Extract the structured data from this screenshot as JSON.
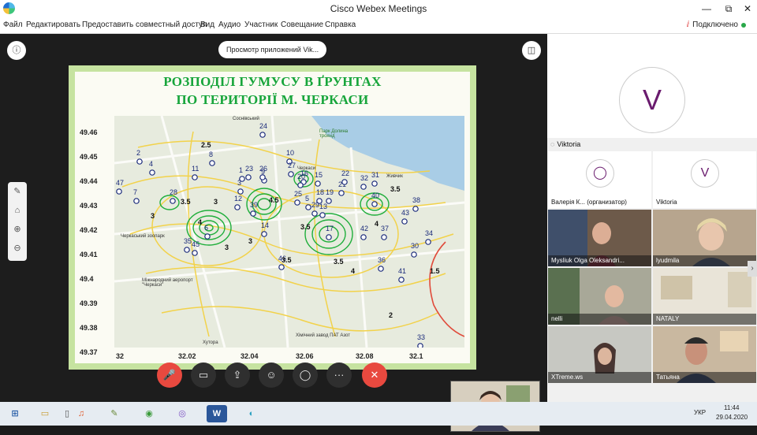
{
  "window": {
    "title": "Cisco Webex Meetings",
    "min": "—",
    "max": "⧉",
    "close": "✕"
  },
  "menu": {
    "items": [
      "Файл",
      "Редактировать",
      "Предоставить совместный доступ",
      "Вид",
      "Аудио",
      "Участник",
      "Совещание",
      "Справка"
    ],
    "status": "Подключено"
  },
  "stage": {
    "view_pill": "Просмотр приложений Vik...",
    "info_icon": "ⓘ",
    "panel_icon": "◫"
  },
  "slide": {
    "title_line1": "РОЗПОДІЛ ГУМУСУ В ҐРУНТАХ",
    "title_line2": "ПО ТЕРИТОРІЇ М. ЧЕРКАСИ",
    "y_ticks": [
      "49.46",
      "49.45",
      "49.44",
      "49.43",
      "49.42",
      "49.41",
      "49.4",
      "49.39",
      "49.38",
      "49.37"
    ],
    "x_ticks": [
      "32",
      "32.02",
      "32.04",
      "32.06",
      "32.08",
      "32.1"
    ],
    "map_labels": {
      "zoo": "Черкаський зоопарк",
      "airport": "Міжнародний аеропорт \"Черкаси\"",
      "plant": "Хімічний завод ПАТ Азот",
      "khutora": "Хутора",
      "park": "Парк Долина троянд",
      "zhyvchyk": "Живчик",
      "sosnivka": "Соснівський",
      "cherkasy": "Черкаси"
    },
    "points": [
      {
        "n": "1"
      },
      {
        "n": "2"
      },
      {
        "n": "3"
      },
      {
        "n": "4"
      },
      {
        "n": "5"
      },
      {
        "n": "6"
      },
      {
        "n": "7"
      },
      {
        "n": "8"
      },
      {
        "n": "9"
      },
      {
        "n": "10"
      },
      {
        "n": "11"
      },
      {
        "n": "12"
      },
      {
        "n": "13"
      },
      {
        "n": "14"
      },
      {
        "n": "15"
      },
      {
        "n": "16"
      },
      {
        "n": "17"
      },
      {
        "n": "18"
      },
      {
        "n": "19"
      },
      {
        "n": "20"
      },
      {
        "n": "21"
      },
      {
        "n": "22"
      },
      {
        "n": "23"
      },
      {
        "n": "24"
      },
      {
        "n": "25"
      },
      {
        "n": "26"
      },
      {
        "n": "27"
      },
      {
        "n": "28"
      },
      {
        "n": "29"
      },
      {
        "n": "30"
      },
      {
        "n": "31"
      },
      {
        "n": "32"
      },
      {
        "n": "33"
      },
      {
        "n": "34"
      },
      {
        "n": "35"
      },
      {
        "n": "36"
      },
      {
        "n": "37"
      },
      {
        "n": "38"
      },
      {
        "n": "39"
      },
      {
        "n": "40"
      },
      {
        "n": "41"
      },
      {
        "n": "42"
      },
      {
        "n": "43"
      },
      {
        "n": "45"
      },
      {
        "n": "46"
      },
      {
        "n": "47"
      }
    ],
    "isoline_values": [
      "2.5",
      "3",
      "3.5",
      "4",
      "4.5",
      "5",
      "1.5",
      "2"
    ]
  },
  "controls": [
    "mute-icon",
    "video-icon",
    "share-icon",
    "participants-icon",
    "chat-icon",
    "more-icon",
    "leave-icon"
  ],
  "control_glyphs": {
    "mute": "🎤",
    "video": "▭",
    "share": "⇪",
    "participants": "☺",
    "chat": "◯",
    "more": "···",
    "leave": "✕"
  },
  "left_tools": [
    "✎",
    "⌂",
    "⊕",
    "⊖"
  ],
  "panel": {
    "active_initial": "V",
    "active_name": "Viktoria",
    "tiles": [
      {
        "name": "Валерія К... (организатор)",
        "kind": "avatar",
        "initial": ""
      },
      {
        "name": "Viktoria",
        "kind": "avatar",
        "initial": "V"
      },
      {
        "name": "Mysliuk Olga Oleksandri...",
        "kind": "video",
        "initial": ""
      },
      {
        "name": "lyudmila",
        "kind": "video",
        "initial": ""
      },
      {
        "name": "nelli",
        "kind": "video",
        "initial": ""
      },
      {
        "name": "NATALY",
        "kind": "video",
        "initial": ""
      },
      {
        "name": "XTreme.ws",
        "kind": "video",
        "initial": ""
      },
      {
        "name": "Татьяна",
        "kind": "video",
        "initial": ""
      }
    ],
    "scroll_arrow": "›"
  },
  "taskbar": {
    "apps": [
      "⊞",
      "▭",
      "▯",
      "♫",
      "✎",
      "◉",
      "◎",
      "W",
      "◐"
    ],
    "tray_lang": "УКР",
    "time": "11:44",
    "date": "29.04.2020"
  },
  "colors": {
    "isoline_green": "#1fae3b",
    "isoline_yellow": "#f2d24a",
    "title_green": "#17a53b",
    "leave_red": "#e8493f",
    "avatar_purple": "#6a1b6e"
  }
}
